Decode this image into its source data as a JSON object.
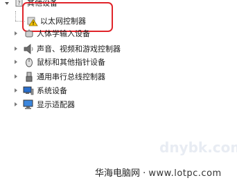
{
  "tree": {
    "other_devices": {
      "label": "其他设备",
      "children": [
        {
          "label": "以太网控制器",
          "status": "warning"
        }
      ]
    },
    "items": [
      {
        "label": "人体学输入设备",
        "icon": "hid-icon"
      },
      {
        "label": "声音、视频和游戏控制器",
        "icon": "speaker-icon"
      },
      {
        "label": "鼠标和其他指针设备",
        "icon": "mouse-icon"
      },
      {
        "label": "通用串行总线控制器",
        "icon": "usb-icon"
      },
      {
        "label": "系统设备",
        "icon": "computer-icon"
      },
      {
        "label": "显示适配器",
        "icon": "monitor-icon"
      }
    ]
  },
  "colors": {
    "highlight": "#e0242a",
    "warning": "#f5c400"
  },
  "watermark": {
    "site": "华海电脑网 · ",
    "url": "www.lotpc.com",
    "faint": "dnybk.com"
  }
}
